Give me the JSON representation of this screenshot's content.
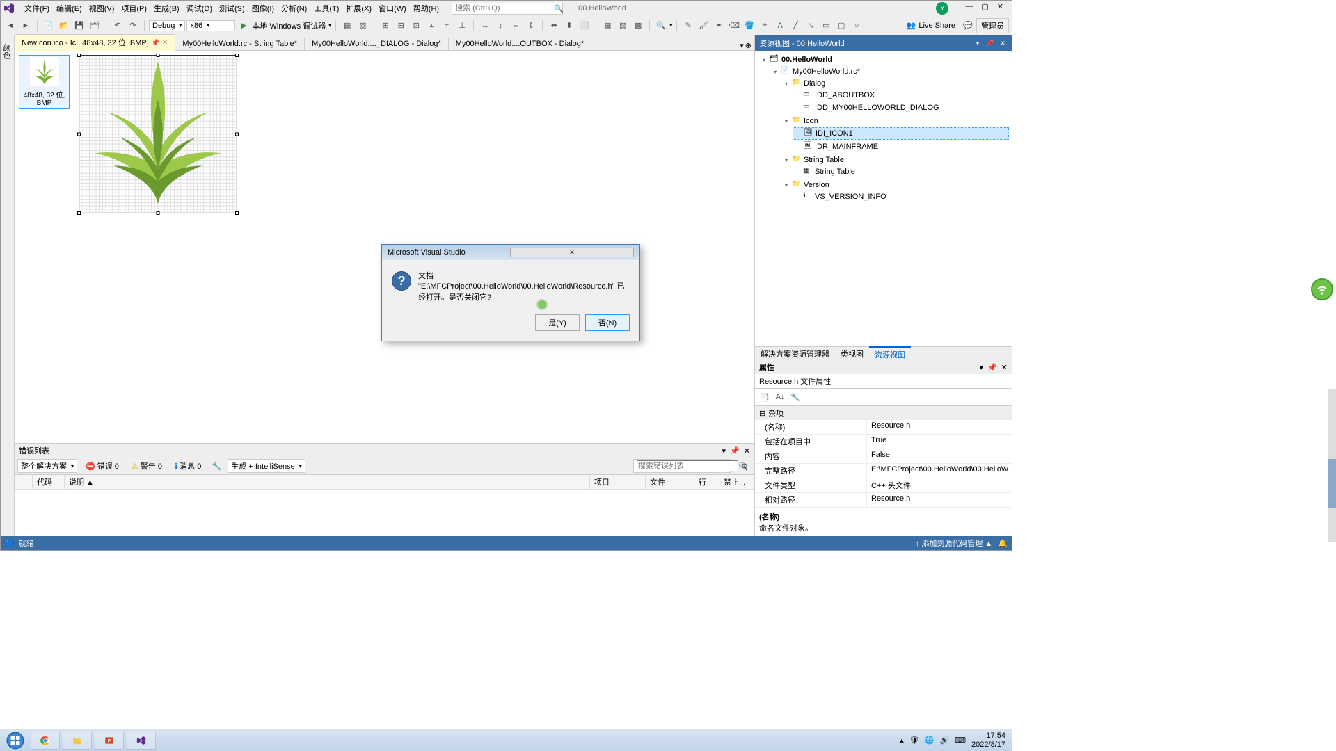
{
  "menubar": {
    "items": [
      "文件(F)",
      "编辑(E)",
      "视图(V)",
      "项目(P)",
      "生成(B)",
      "调试(D)",
      "测试(S)",
      "图像(I)",
      "分析(N)",
      "工具(T)",
      "扩展(X)",
      "窗口(W)",
      "帮助(H)"
    ],
    "search_placeholder": "搜索 (Ctrl+Q)",
    "doc_title": "00.HelloWorld",
    "avatar": "Y"
  },
  "toolbar": {
    "config": "Debug",
    "platform": "x86",
    "run_label": "本地 Windows 调试器",
    "live_share": "Live Share",
    "admin": "管理员"
  },
  "tabs": [
    {
      "label": "NewIcon.ico - Ic...48x48, 32 位, BMP]",
      "active": true,
      "pinned": true
    },
    {
      "label": "My00HelloWorld.rc - String Table*",
      "active": false
    },
    {
      "label": "My00HelloWorld...._DIALOG - Dialog*",
      "active": false
    },
    {
      "label": "My00HelloWorld....OUTBOX - Dialog*",
      "active": false
    }
  ],
  "left_strip": "颜色",
  "thumb": {
    "caption": "48x48, 32 位, BMP"
  },
  "resource_view": {
    "title": "资源视图 - 00.HelloWorld",
    "root": "00.HelloWorld",
    "rc": "My00HelloWorld.rc*",
    "folders": {
      "dialog": "Dialog",
      "icon": "Icon",
      "string_table": "String Table",
      "version": "Version"
    },
    "dialog_items": [
      "IDD_ABOUTBOX",
      "IDD_MY00HELLOWORLD_DIALOG"
    ],
    "icon_items": [
      "IDI_ICON1",
      "IDR_MAINFRAME"
    ],
    "string_items": [
      "String Table"
    ],
    "version_items": [
      "VS_VERSION_INFO"
    ]
  },
  "right_tabs": [
    "解决方案资源管理器",
    "类视图",
    "资源视图"
  ],
  "right_tabs_active": 2,
  "props": {
    "header": "属性",
    "subject": "Resource.h 文件属性",
    "section": "杂项",
    "rows": [
      {
        "k": "(名称)",
        "v": "Resource.h"
      },
      {
        "k": "包括在项目中",
        "v": "True"
      },
      {
        "k": "内容",
        "v": "False"
      },
      {
        "k": "完整路径",
        "v": "E:\\MFCProject\\00.HelloWorld\\00.HelloW"
      },
      {
        "k": "文件类型",
        "v": "C++ 头文件"
      },
      {
        "k": "相对路径",
        "v": "Resource.h"
      }
    ],
    "desc_title": "(名称)",
    "desc_body": "命名文件对象。"
  },
  "errorlist": {
    "title": "错误列表",
    "scope": "整个解决方案",
    "errors": "错误 0",
    "warnings": "警告 0",
    "messages": "消息 0",
    "build_combo": "生成 + IntelliSense",
    "filter_placeholder": "搜索错误列表",
    "columns": [
      "",
      "代码",
      "说明 ▲",
      "项目",
      "文件",
      "行",
      "禁止..."
    ]
  },
  "status": {
    "left": "就绪",
    "right": "↑ 添加到源代码管理 ▲"
  },
  "dialog": {
    "title": "Microsoft Visual Studio",
    "message": "文档 \"E:\\MFCProject\\00.HelloWorld\\00.HelloWorld\\Resource.h\" 已经打开。是否关闭它?",
    "yes": "是(Y)",
    "no": "否(N)"
  },
  "taskbar": {
    "time": "17:54",
    "date": "2022/8/17"
  }
}
